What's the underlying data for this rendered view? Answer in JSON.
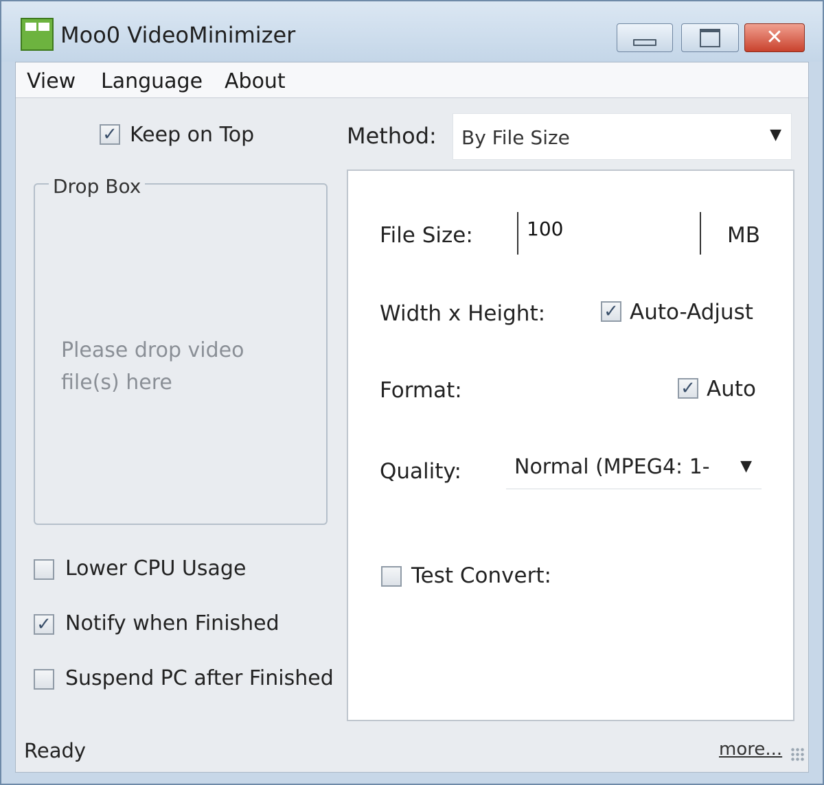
{
  "window": {
    "title": "Moo0 VideoMinimizer",
    "controls": {
      "close_glyph": "✕"
    }
  },
  "menu": {
    "items": [
      {
        "label": "View"
      },
      {
        "label": "Language"
      },
      {
        "label": "About"
      }
    ]
  },
  "left": {
    "keep_on_top": {
      "label": "Keep on Top",
      "checked": true
    },
    "drop_box": {
      "title": "Drop Box",
      "hint": "Please drop video file(s) here"
    },
    "options": [
      {
        "label": "Lower CPU Usage",
        "checked": false
      },
      {
        "label": "Notify when Finished",
        "checked": true
      },
      {
        "label": "Suspend PC after Finished",
        "checked": false
      }
    ]
  },
  "method": {
    "label": "Method:",
    "value": "By File Size"
  },
  "panel": {
    "file_size": {
      "label": "File Size:",
      "value": "100",
      "unit": "MB"
    },
    "dimensions": {
      "label": "Width x Height:",
      "auto_label": "Auto-Adjust",
      "auto_checked": true
    },
    "format": {
      "label": "Format:",
      "auto_label": "Auto",
      "auto_checked": true
    },
    "quality": {
      "label": "Quality:",
      "value": "Normal (MPEG4: 1-"
    },
    "test_convert": {
      "label": "Test Convert:",
      "checked": false
    }
  },
  "status": {
    "text": "Ready",
    "link": "more..."
  },
  "icons": {
    "check": "✓",
    "combo_arrow": "▼"
  },
  "colors": {
    "frame": "#c7d7e8",
    "close_button": "#c9422d",
    "client_bg": "#e9ecf0",
    "panel_bg": "#ffffff"
  }
}
